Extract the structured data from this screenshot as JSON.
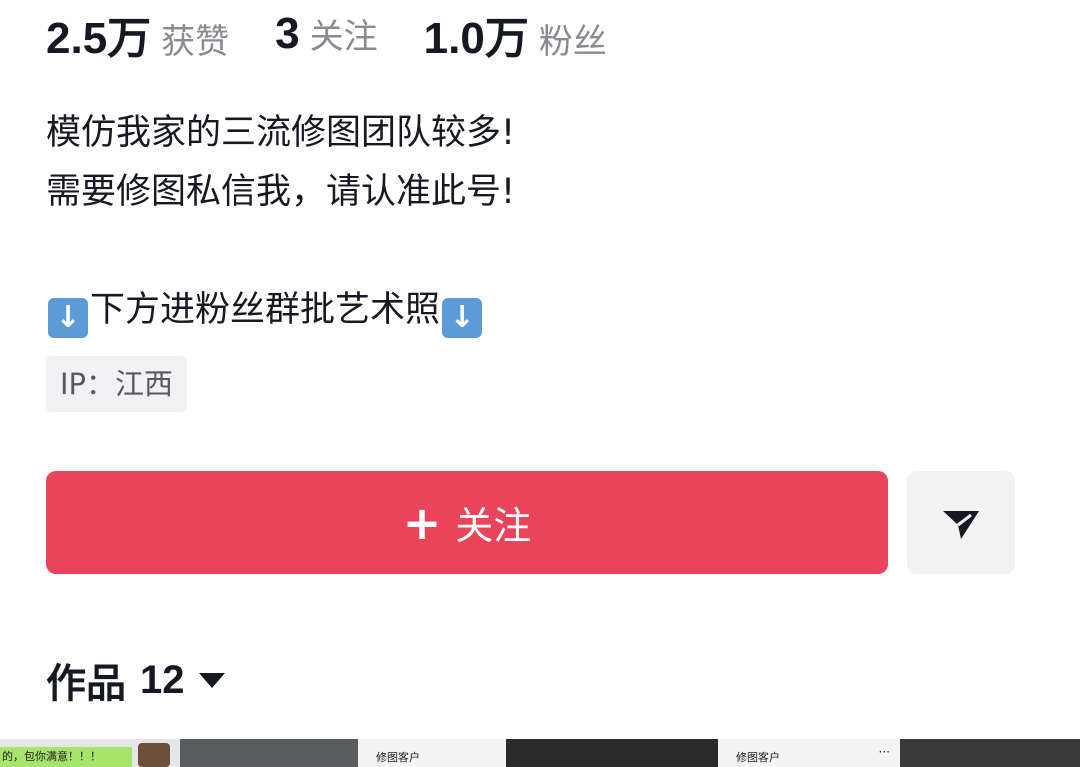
{
  "stats": [
    {
      "value": "2.5万",
      "label": "获赞"
    },
    {
      "value": "3",
      "label": "关注"
    },
    {
      "value": "1.0万",
      "label": "粉丝"
    }
  ],
  "bio": {
    "line1": "模仿我家的三流修图团队较多!",
    "line2": "需要修图私信我，请认准此号!",
    "line3": "下方进粉丝群批艺术照",
    "icon": "arrow-down-emoji"
  },
  "ip": {
    "label": "IP：江西"
  },
  "follow_button": {
    "icon": "plus-icon",
    "label": "关注",
    "color": "#e9445a"
  },
  "share_button": {
    "icon": "send-icon"
  },
  "works": {
    "label": "作品",
    "count": "12",
    "icon": "caret-down-icon"
  },
  "thumbnails": [
    {
      "text": "的，包你满意！！！"
    },
    {
      "text": ""
    },
    {
      "text": "修图客户"
    },
    {
      "text": ""
    },
    {
      "text": "修图客户",
      "menu": "···"
    },
    {
      "text": ""
    }
  ]
}
